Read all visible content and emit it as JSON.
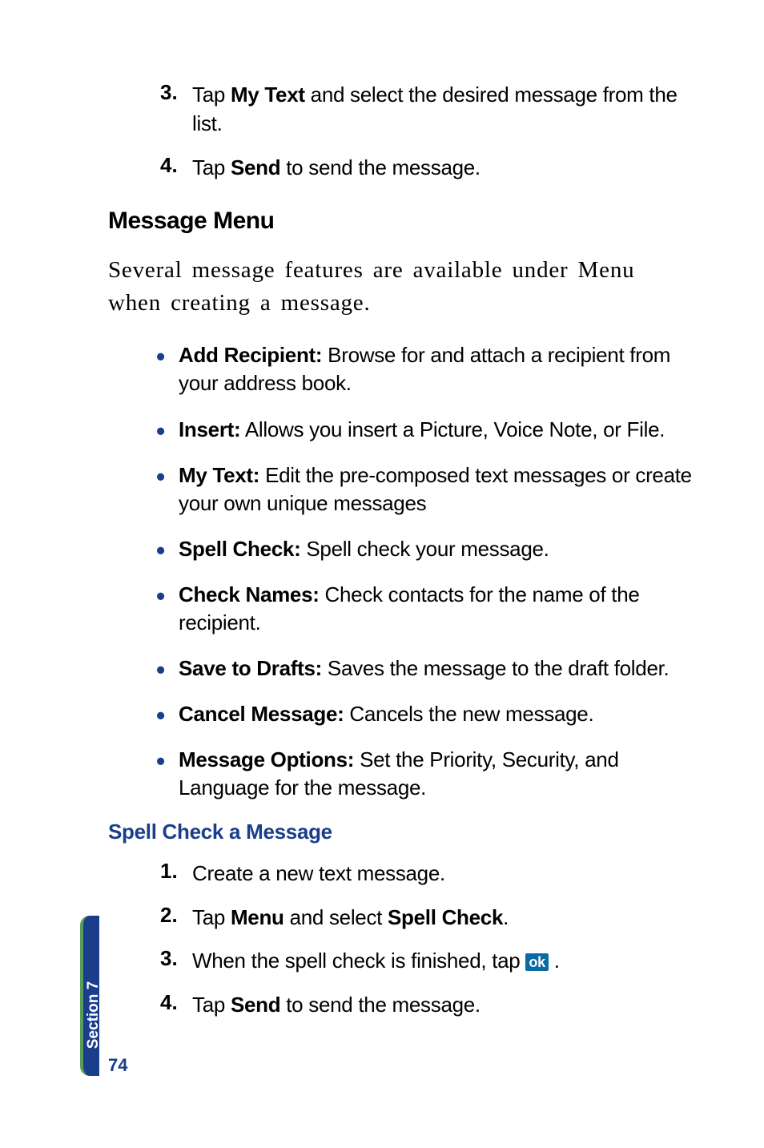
{
  "steps_top": [
    {
      "num": "3.",
      "prefix": "Tap ",
      "bold": "My Text",
      "suffix": " and select the desired message from the list."
    },
    {
      "num": "4.",
      "prefix": "Tap ",
      "bold": "Send",
      "suffix": " to send the message."
    }
  ],
  "heading_message_menu": "Message Menu",
  "intro_paragraph": "Several message features are available under Menu when creating a message.",
  "bullets": [
    {
      "bold": "Add Recipient:",
      "text": " Browse for and attach a recipient from your address book."
    },
    {
      "bold": "Insert:",
      "text": " Allows you insert a Picture, Voice Note, or File."
    },
    {
      "bold": "My Text:",
      "text": " Edit the pre-composed text messages or create your own unique messages"
    },
    {
      "bold": "Spell Check:",
      "text": " Spell check your message."
    },
    {
      "bold": "Check Names:",
      "text": " Check contacts for the name of the recipient."
    },
    {
      "bold": "Save to Drafts:",
      "text": " Saves the message to the draft folder."
    },
    {
      "bold": "Cancel Message:",
      "text": " Cancels the new message."
    },
    {
      "bold": "Message Options:",
      "text": " Set the Priority, Security, and Language for the message."
    }
  ],
  "heading_spell_check": "Spell Check a Message",
  "spell_steps": {
    "s1": {
      "num": "1.",
      "text": "Create a new text message."
    },
    "s2": {
      "num": "2.",
      "prefix": "Tap ",
      "bold1": "Menu",
      "mid": " and select ",
      "bold2": "Spell Check",
      "suffix": "."
    },
    "s3": {
      "num": "3.",
      "prefix": "When the spell check is finished, tap ",
      "icon": "ok",
      "suffix": "."
    },
    "s4": {
      "num": "4.",
      "prefix": "Tap ",
      "bold": "Send",
      "suffix": " to send the message."
    }
  },
  "side_tab": "Section 7",
  "page_number": "74"
}
